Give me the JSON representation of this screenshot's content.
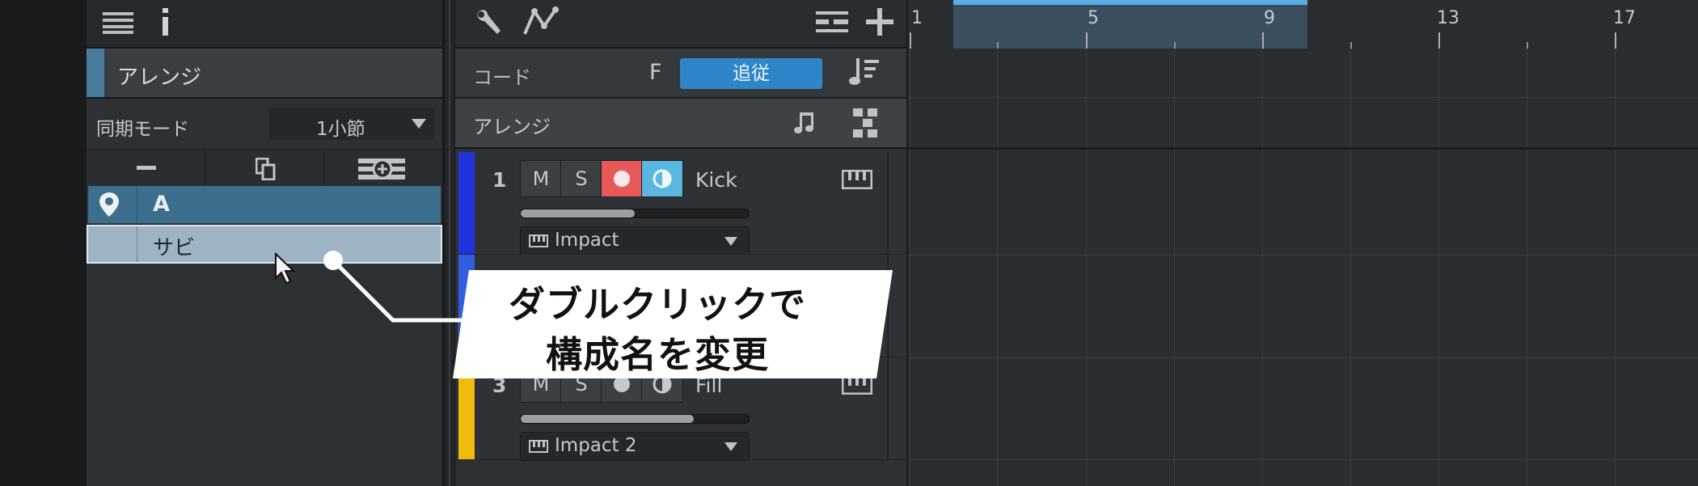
{
  "arrange_panel": {
    "title": "アレンジ",
    "sync_mode_label": "同期モード",
    "sync_mode_value": "1小節",
    "sections": [
      {
        "name": "A",
        "selected": true
      },
      {
        "name": "サビ",
        "editing": true
      }
    ]
  },
  "chord_track": {
    "label": "コード",
    "key": "F",
    "follow_button": "追従"
  },
  "arranger_track": {
    "label": "アレンジ"
  },
  "tracks": [
    {
      "number": "1",
      "name": "Kick",
      "m": "M",
      "s": "S",
      "instrument": "Impact",
      "color": "#2233dd",
      "volume": 0.5
    },
    {
      "number": "3",
      "name": "Fill",
      "m": "M",
      "s": "S",
      "instrument": "Impact 2",
      "color": "#f2b90e",
      "volume": 0.76
    }
  ],
  "ruler": {
    "bars": [
      "1",
      "5",
      "9",
      "13",
      "17"
    ]
  },
  "callout": {
    "line1": "ダブルクリックで",
    "line2": "構成名を変更"
  },
  "colors": {
    "accent": "#2e86c8",
    "record": "#e85a5a",
    "monitor": "#5ab8e0",
    "section_selected": "#3c6f8d",
    "section_editing": "#9eb3c4"
  }
}
